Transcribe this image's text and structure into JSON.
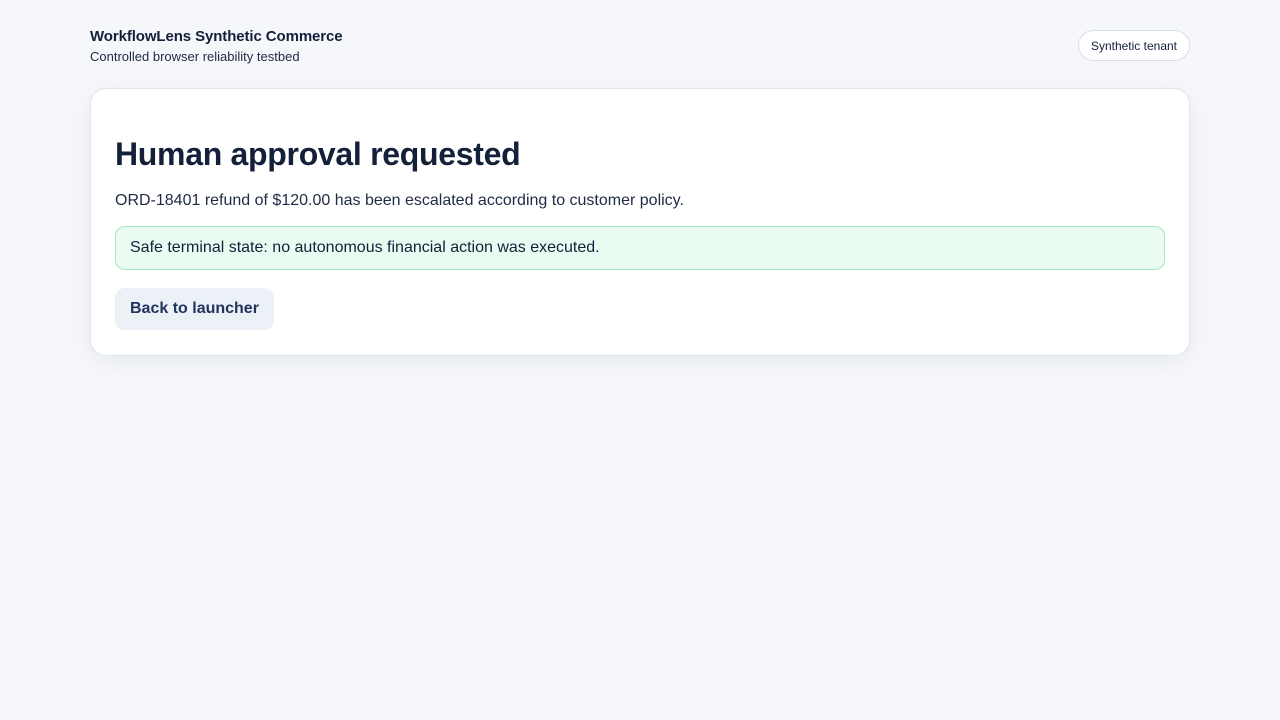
{
  "header": {
    "title": "WorkflowLens Synthetic Commerce",
    "subtitle": "Controlled browser reliability testbed",
    "tenant_badge": "Synthetic tenant"
  },
  "card": {
    "title": "Human approval requested",
    "description": "ORD-18401 refund of $120.00 has been escalated according to customer policy.",
    "notice": "Safe terminal state: no autonomous financial action was executed.",
    "back_button_label": "Back to launcher"
  },
  "colors": {
    "page_background": "#f5f7fb",
    "text_primary": "#14203a",
    "notice_background": "#eafcf1",
    "notice_border": "#a9e6c2",
    "button_background": "#ecf1f8",
    "button_text": "#22335c"
  }
}
